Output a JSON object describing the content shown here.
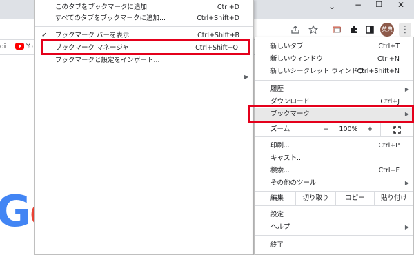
{
  "window": {
    "minimize": "−",
    "maximize": "☐",
    "close": "✕",
    "chevron": "⌄"
  },
  "toolbar": {
    "avatar_text": "英典",
    "more_icon": "⋮"
  },
  "bookmarks_bar": {
    "items": [
      "di",
      "Yo"
    ]
  },
  "bookmark_submenu": {
    "items": [
      {
        "label": "このタブをブックマークに追加...",
        "shortcut": "Ctrl+D"
      },
      {
        "label": "すべてのタブをブックマークに追加...",
        "shortcut": "Ctrl+Shift+D"
      },
      {
        "label": "ブックマーク バーを表示",
        "shortcut": "Ctrl+Shift+B",
        "checked": true
      },
      {
        "label": "ブックマーク マネージャ",
        "shortcut": "Ctrl+Shift+O",
        "highlighted": true
      },
      {
        "label": "ブックマークと設定をインポート...",
        "shortcut": ""
      }
    ],
    "check_mark": "✓",
    "arrow": "▶"
  },
  "main_menu": {
    "new_tab": {
      "label": "新しいタブ",
      "shortcut": "Ctrl+T"
    },
    "new_window": {
      "label": "新しいウィンドウ",
      "shortcut": "Ctrl+N"
    },
    "new_incognito": {
      "label": "新しいシークレット ウィンドウ",
      "shortcut": "Ctrl+Shift+N"
    },
    "history": {
      "label": "履歴"
    },
    "downloads": {
      "label": "ダウンロード",
      "shortcut": "Ctrl+J"
    },
    "bookmarks": {
      "label": "ブックマーク"
    },
    "zoom": {
      "label": "ズーム",
      "minus": "−",
      "value": "100%",
      "plus": "+"
    },
    "print": {
      "label": "印刷...",
      "shortcut": "Ctrl+P"
    },
    "cast": {
      "label": "キャスト..."
    },
    "find": {
      "label": "検索...",
      "shortcut": "Ctrl+F"
    },
    "more_tools": {
      "label": "その他のツール"
    },
    "edit": {
      "label": "編集",
      "cut": "切り取り",
      "copy": "コピー",
      "paste": "貼り付け"
    },
    "settings": {
      "label": "設定"
    },
    "help": {
      "label": "ヘルプ"
    },
    "exit": {
      "label": "終了"
    },
    "arrow": "▶"
  },
  "page": {
    "logo_g": "G",
    "logo_o": "o"
  },
  "highlight_color": "#e4001b"
}
